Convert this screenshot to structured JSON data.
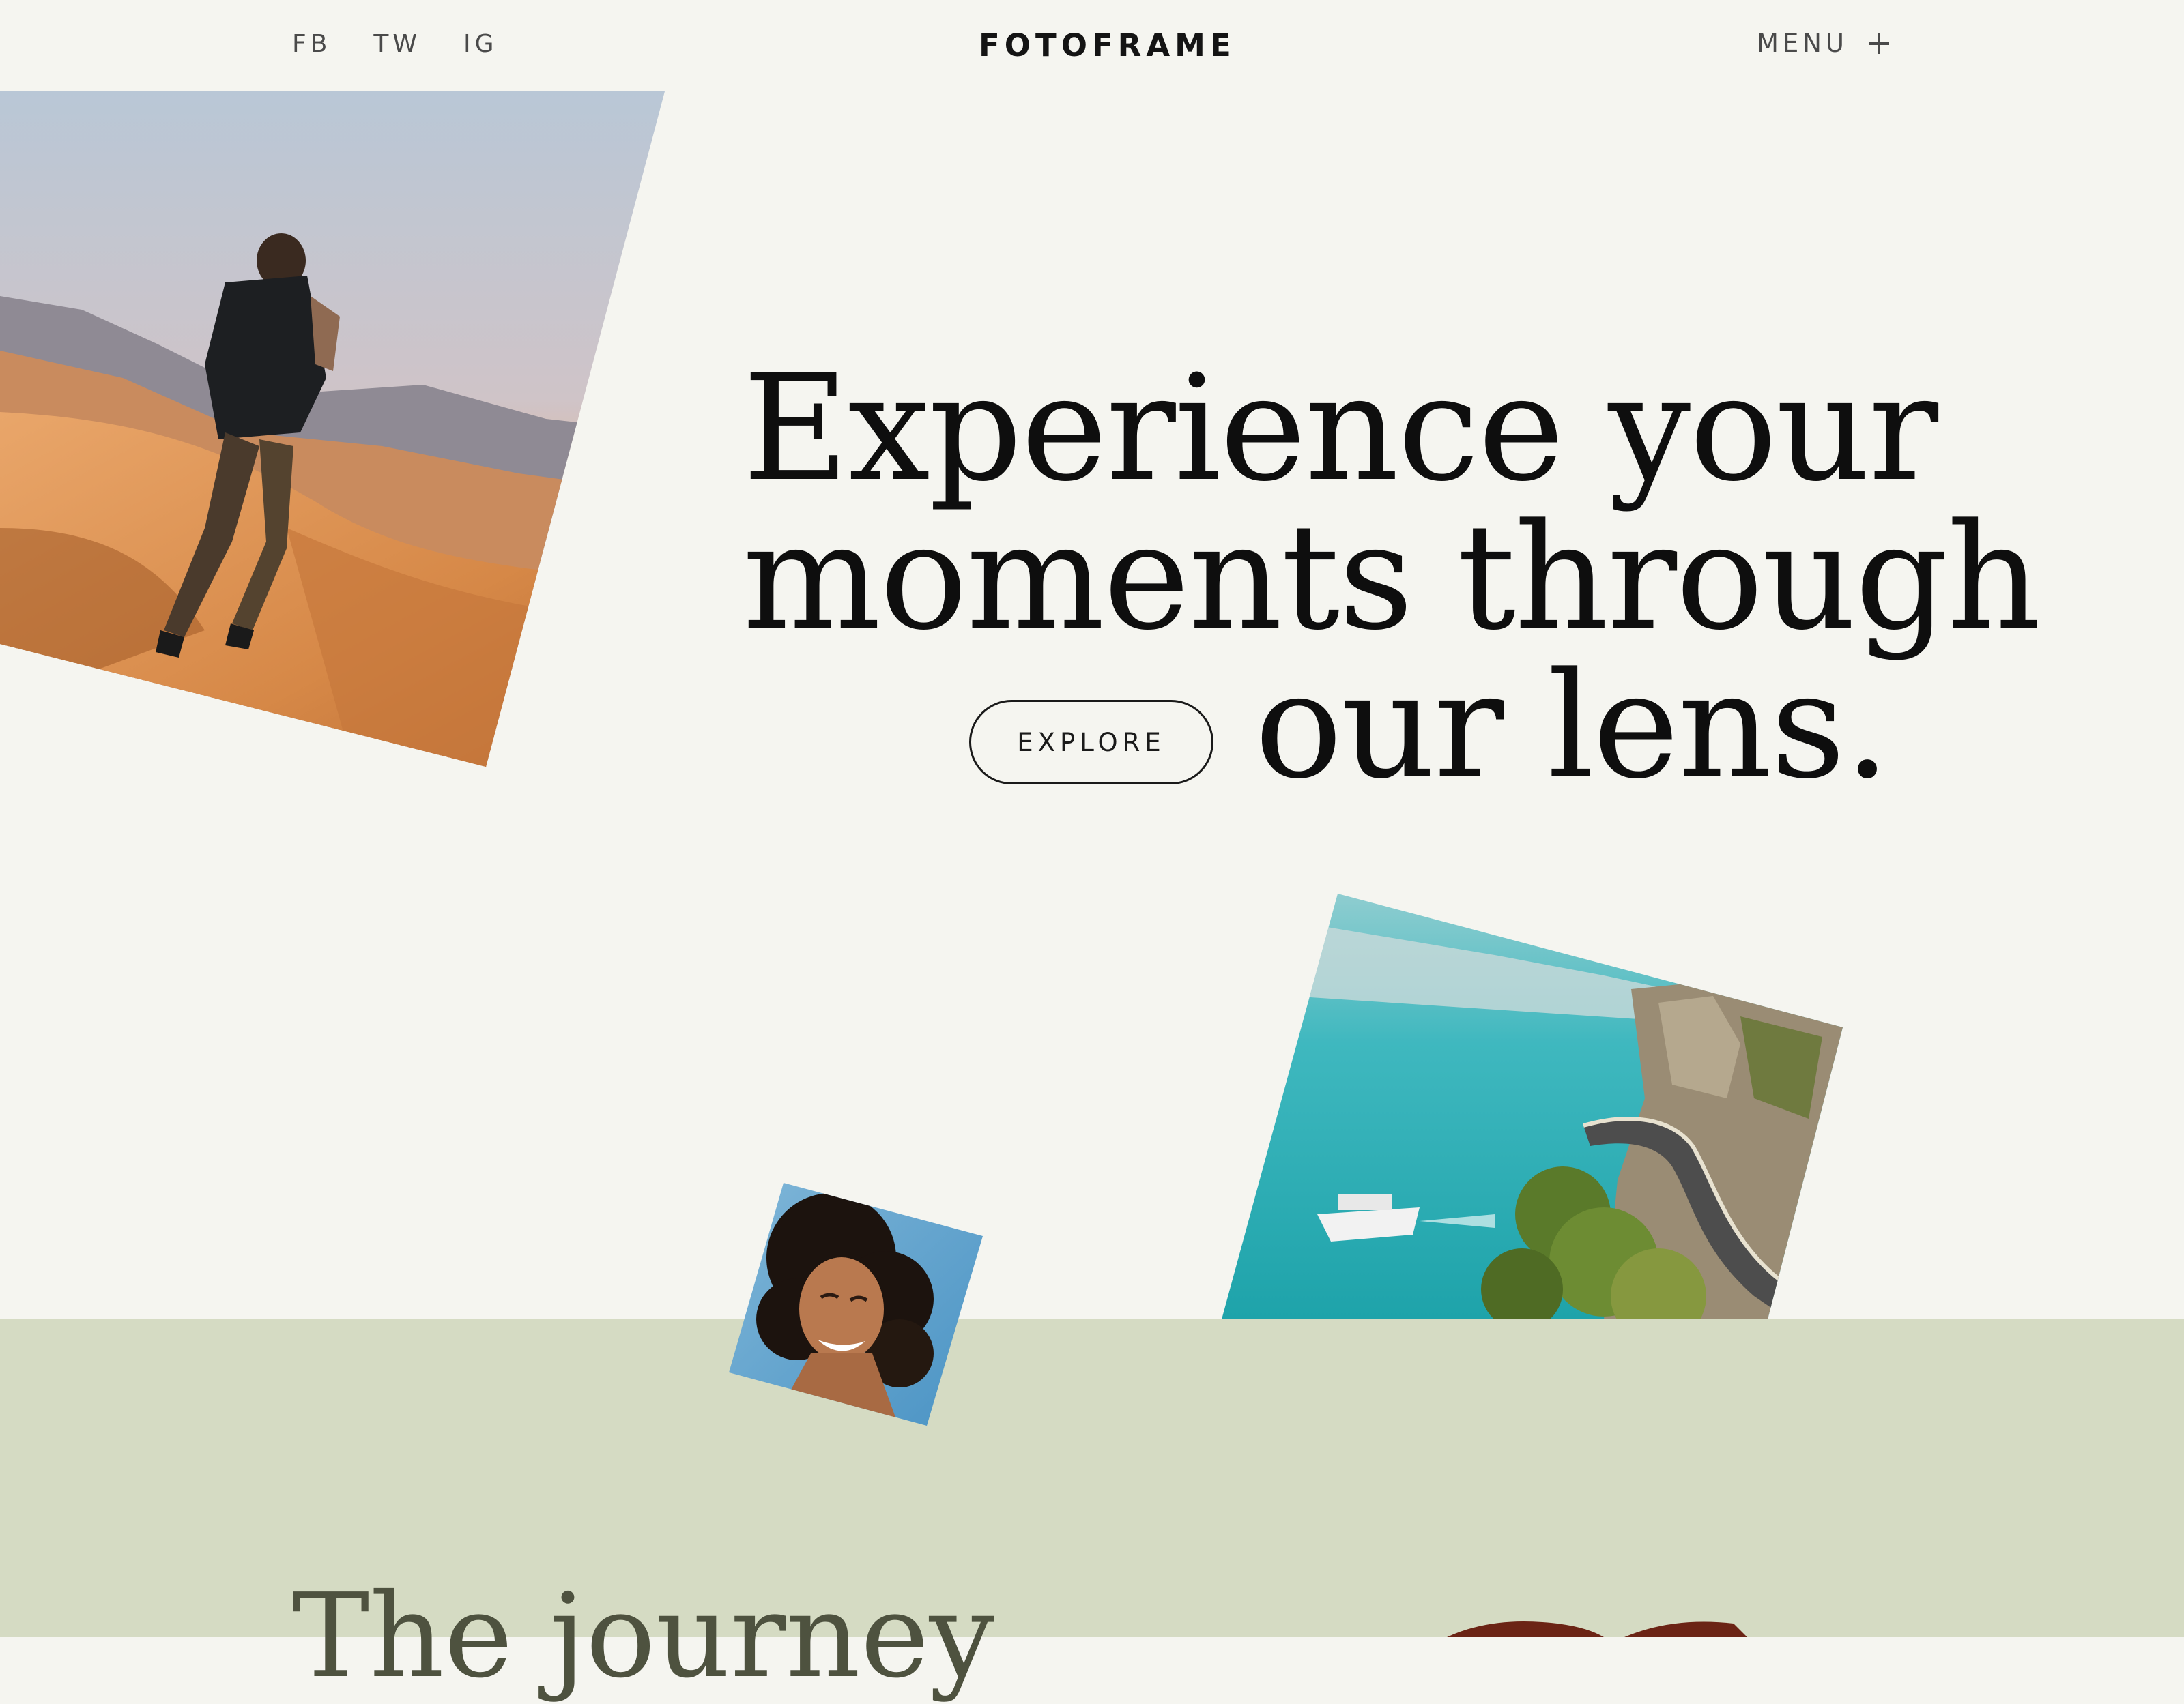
{
  "header": {
    "social_links": [
      "FB",
      "TW",
      "IG"
    ],
    "brand": "FOTOFRAME",
    "menu_label": "MENU",
    "menu_icon": "plus-icon"
  },
  "hero": {
    "headline_lines": [
      "Experience your",
      "moments through",
      "our lens."
    ],
    "cta_label": "EXPLORE",
    "photos": [
      "photographer-in-desert-dunes",
      "coastal-road-and-boat-on-turquoise-lake",
      "smiling-woman-portrait"
    ]
  },
  "section": {
    "title": "The journey"
  },
  "colors": {
    "page_background": "#f5f5f0",
    "band_background": "#d5dbc3",
    "text": "#111111",
    "muted_text": "#4a4a4a",
    "section_title": "#4e523f"
  }
}
